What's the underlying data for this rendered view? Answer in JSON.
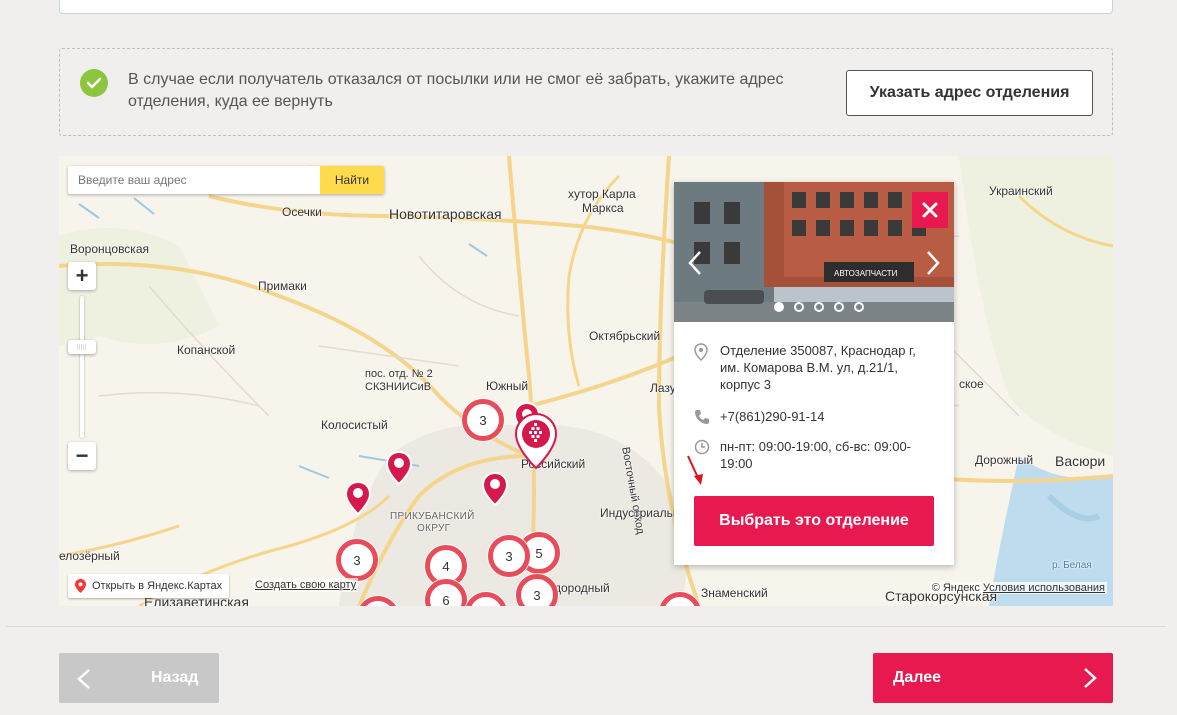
{
  "return_block": {
    "text": "В случае если получатель отказался от посылки или не смог её забрать, укажите адрес отделения, куда ее вернуть",
    "button": "Указать адрес отделения"
  },
  "map": {
    "search_placeholder": "Введите ваш адрес",
    "search_button": "Найти",
    "zoom_in": "+",
    "zoom_out": "−",
    "open_yandex": "Открыть в Яндекс.Картах",
    "create_map": "Создать свою карту",
    "copyright_owner": "© Яндекс",
    "copyright_terms": "Условия использования",
    "places": {
      "novotitarovskaya": "Новотитаровская",
      "khutor_karla_marksa_1": "хутор Карла",
      "khutor_karla_marksa_2": "Маркса",
      "osechki": "Осечки",
      "vorontsovskaya": "Воронцовская",
      "primaki": "Примаки",
      "oktyabrsky": "Октябрьский",
      "kopanskoy": "Копанской",
      "pos_otd_1": "пос. отд. № 2",
      "pos_otd_2": "СКЗНИИСиВ",
      "yuzhny": "Южный",
      "lazurny": "Лазу",
      "kolosisty": "Колосистый",
      "rossiysky": "Российский",
      "vostochny_obkhod": "Восточный обход",
      "prikubansky_1": "ПРИКУБАНСКИЙ",
      "prikubansky_2": "ОКРУГ",
      "industrialny": "Индустриальн",
      "ozerny": "елозёрный",
      "elizavetinskaya": "Елизаветинская",
      "plodorodny": "дородный",
      "znamensky": "Знаменский",
      "starokorsunskaya": "Старокорсунская",
      "ukrainsky": "Украинский",
      "skoe": "ское",
      "dorozhny": "Дорожный",
      "vasyurinskaya": "Васюри",
      "belaya": "р. Белая"
    },
    "clusters": [
      "3",
      "3",
      "5",
      "4",
      "3",
      "6",
      "3"
    ]
  },
  "popup": {
    "address": "Отделение 350087, Краснодар г, им. Комарова В.М. ул, д.21/1, корпус 3",
    "phone": "+7(861)290-91-14",
    "hours": "пн-пт: 09:00-19:00, сб-вс: 09:00-19:00",
    "select_button": "Выбрать это отделение",
    "photo_sign": "АВТОЗАПЧАСТИ",
    "photo_count": 5,
    "photo_active_index": 0
  },
  "nav": {
    "back": "Назад",
    "next": "Далее"
  },
  "colors": {
    "accent": "#e8194f",
    "cluster": "#e74c5a",
    "check": "#8cc63f",
    "search_button": "#ffdb4d"
  }
}
